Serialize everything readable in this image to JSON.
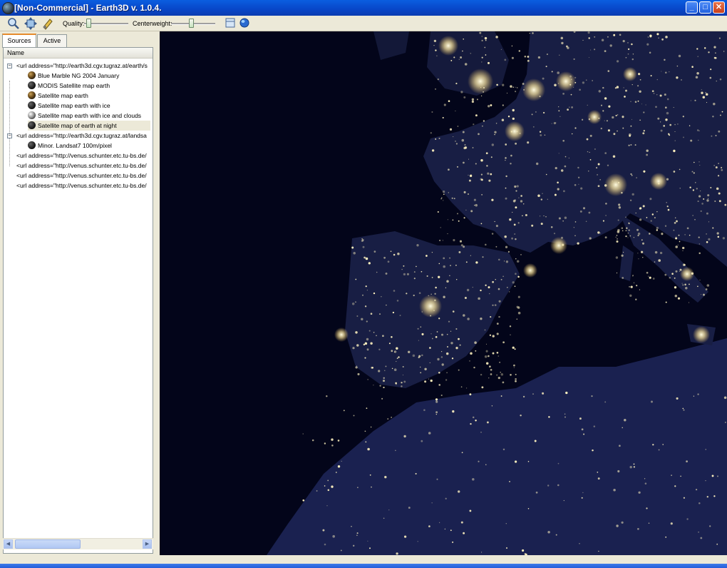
{
  "window": {
    "title": "[Non-Commercial] - Earth3D v. 1.0.4.",
    "minimize_label": "_",
    "maximize_label": "□",
    "close_label": "✕"
  },
  "toolbar": {
    "quality_label": "Quality:",
    "centerweight_label": "Centerweight:",
    "icons": [
      "zoom-icon",
      "move-icon",
      "settings-icon",
      "view-icon",
      "globe-icon"
    ],
    "quality_slider_value": 0.05,
    "centerweight_slider_value": 0.45
  },
  "left_panel": {
    "tabs": [
      {
        "label": "Sources",
        "selected": true
      },
      {
        "label": "Active",
        "selected": false
      }
    ],
    "column_header": "Name",
    "tree": [
      {
        "label": "<url address=\"http://earth3d.cgv.tugraz.at/earth/s",
        "level": 0,
        "expanded": true
      },
      {
        "label": "Blue Marble NG 2004 January",
        "level": 1
      },
      {
        "label": "MODIS Satellite map earth",
        "level": 1
      },
      {
        "label": "Satellite map earth",
        "level": 1
      },
      {
        "label": "Satellite map earth with ice",
        "level": 1
      },
      {
        "label": "Satellite map earth with ice and clouds",
        "level": 1
      },
      {
        "label": "Satellite map of earth at night",
        "level": 1,
        "selected": true
      },
      {
        "label": "<url address=\"http://earth3d.cgv.tugraz.at/landsa",
        "level": 0,
        "expanded": true
      },
      {
        "label": "Minor. Landsat7 100m/pixel",
        "level": 1
      },
      {
        "label": "<url address=\"http://venus.schunter.etc.tu-bs.de/",
        "level": 0
      },
      {
        "label": "<url address=\"http://venus.schunter.etc.tu-bs.de/",
        "level": 0
      },
      {
        "label": "<url address=\"http://venus.schunter.etc.tu-bs.de/",
        "level": 0
      },
      {
        "label": "<url address=\"http://venus.schunter.etc.tu-bs.de/",
        "level": 0
      }
    ]
  },
  "colors": {
    "ocean": "#03051a",
    "land": "#1a2046",
    "lights": "#fff6c8"
  }
}
